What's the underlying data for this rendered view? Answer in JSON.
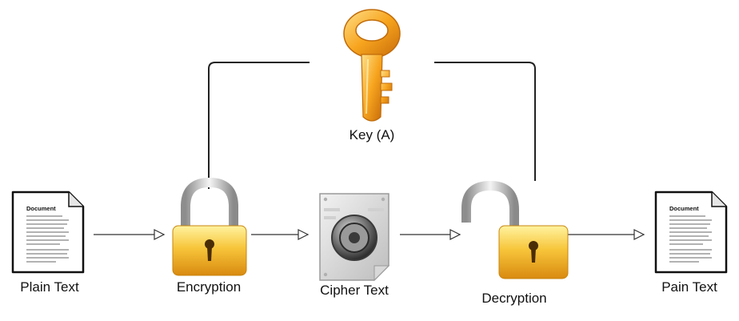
{
  "key": {
    "label": "Key (A)",
    "icon": "key-icon",
    "color": "#f0a020"
  },
  "nodes": [
    {
      "id": "plain",
      "label": "Plain Text",
      "icon": "document-icon",
      "doc_title": "Document"
    },
    {
      "id": "enc",
      "label": "Encryption",
      "icon": "closed-padlock-icon"
    },
    {
      "id": "cipher",
      "label": "Cipher Text",
      "icon": "safe-dial-icon"
    },
    {
      "id": "dec",
      "label": "Decryption",
      "icon": "open-padlock-icon"
    },
    {
      "id": "out",
      "label": "Pain Text",
      "icon": "document-icon",
      "doc_title": "Document"
    }
  ],
  "edges": [
    {
      "from": "plain",
      "to": "enc"
    },
    {
      "from": "enc",
      "to": "cipher"
    },
    {
      "from": "cipher",
      "to": "dec"
    },
    {
      "from": "dec",
      "to": "out"
    },
    {
      "from": "key",
      "to": "enc"
    },
    {
      "from": "key",
      "to": "dec"
    }
  ]
}
